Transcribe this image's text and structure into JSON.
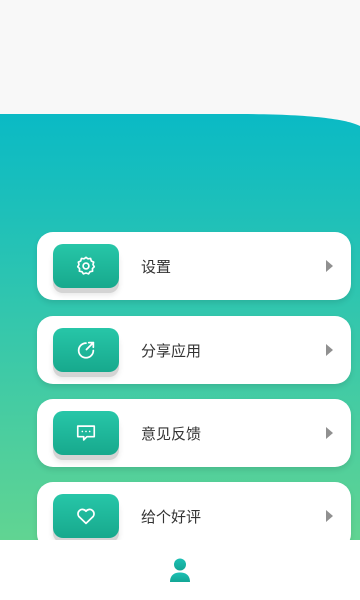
{
  "colors": {
    "gradient_top": "#0abac5",
    "gradient_bottom": "#6dd88b",
    "icon_button": "#1fb99a",
    "chevron": "#909090",
    "label_text": "#333333"
  },
  "menu": {
    "items": [
      {
        "label": "设置",
        "icon": "gear-icon"
      },
      {
        "label": "分享应用",
        "icon": "share-icon"
      },
      {
        "label": "意见反馈",
        "icon": "feedback-icon"
      },
      {
        "label": "给个好评",
        "icon": "heart-icon"
      }
    ]
  },
  "bottom_nav": {
    "active_icon": "user-icon"
  }
}
